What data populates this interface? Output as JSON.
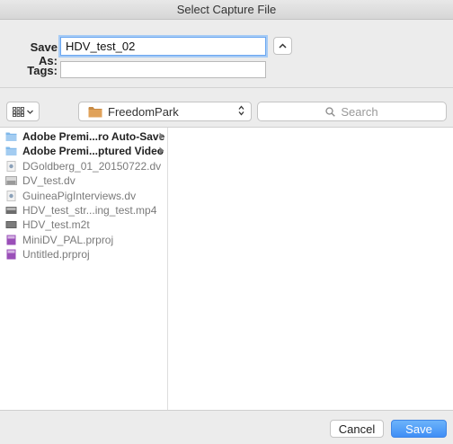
{
  "window": {
    "title": "Select Capture File"
  },
  "save_as": {
    "label": "Save As:",
    "value": "HDV_test_02"
  },
  "tags": {
    "label": "Tags:",
    "value": ""
  },
  "toolbar": {
    "view_icon": "icon-grid-icon",
    "location": "FreedomPark",
    "search_placeholder": "Search"
  },
  "files": [
    {
      "name": "Adobe Premi...ro Auto-Save",
      "kind": "folder",
      "has_children": true,
      "enabled": true
    },
    {
      "name": "Adobe Premi...ptured Video",
      "kind": "folder",
      "has_children": true,
      "enabled": true
    },
    {
      "name": "DGoldberg_01_20150722.dv",
      "kind": "dv",
      "has_children": false,
      "enabled": false
    },
    {
      "name": "DV_test.dv",
      "kind": "dv-thumb",
      "has_children": false,
      "enabled": false
    },
    {
      "name": "GuineaPigInterviews.dv",
      "kind": "dv",
      "has_children": false,
      "enabled": false
    },
    {
      "name": "HDV_test_str...ing_test.mp4",
      "kind": "video-thumb",
      "has_children": false,
      "enabled": false
    },
    {
      "name": "HDV_test.m2t",
      "kind": "video-thumb-dark",
      "has_children": false,
      "enabled": false
    },
    {
      "name": "MiniDV_PAL.prproj",
      "kind": "prproj",
      "has_children": false,
      "enabled": false
    },
    {
      "name": "Untitled.prproj",
      "kind": "prproj",
      "has_children": false,
      "enabled": false
    }
  ],
  "buttons": {
    "cancel": "Cancel",
    "save": "Save"
  },
  "colors": {
    "accent": "#3f8ef6",
    "folder": "#7fb8ea",
    "prproj": "#9a4fb8"
  }
}
